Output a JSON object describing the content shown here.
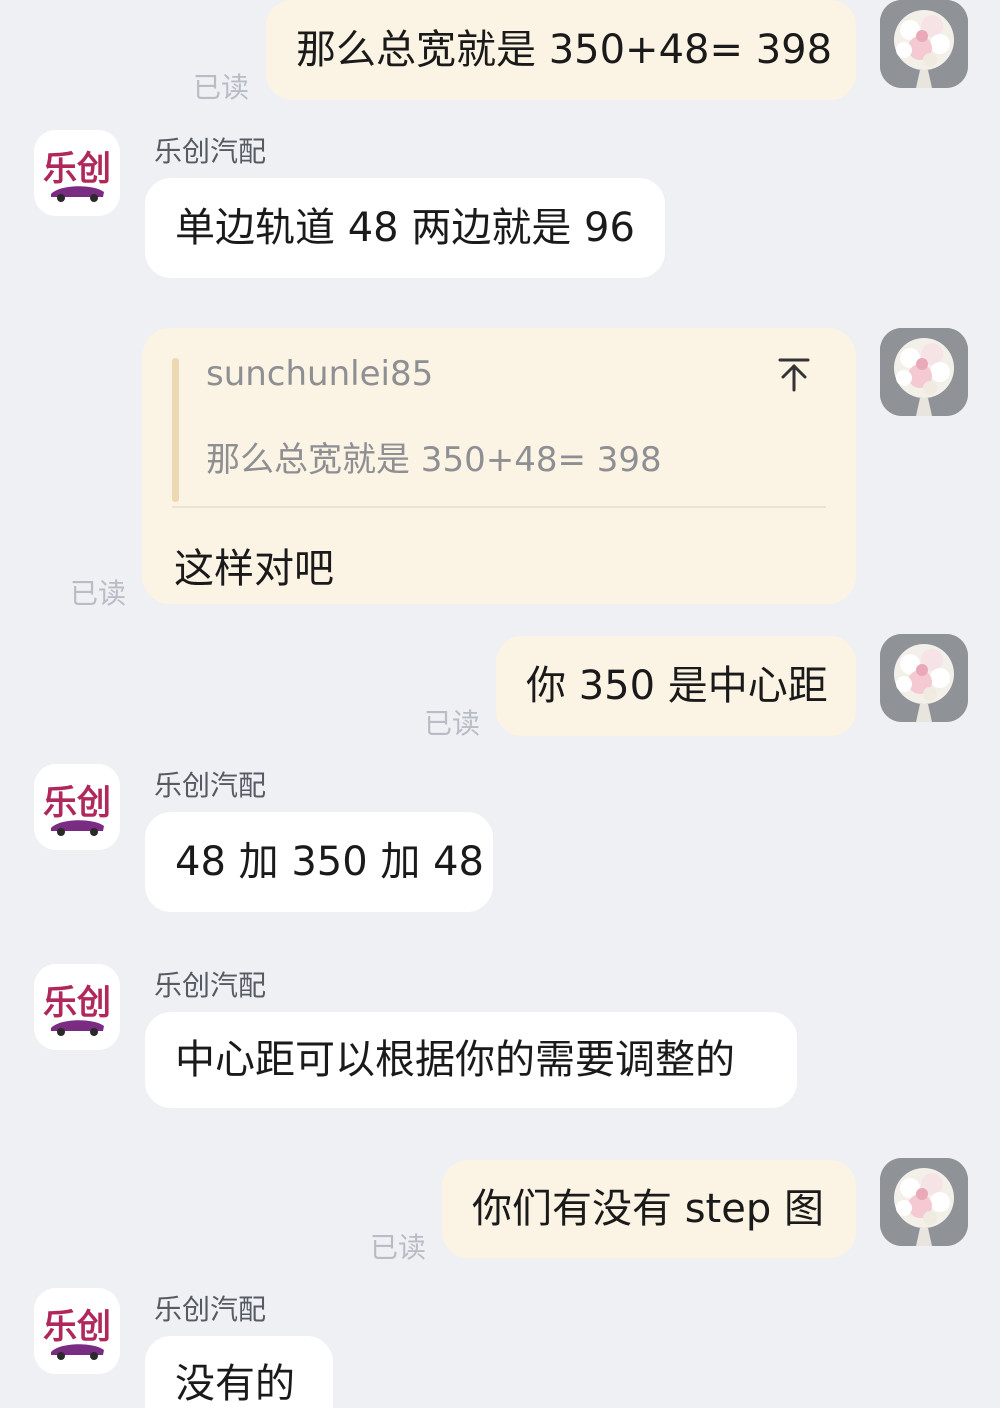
{
  "messages": {
    "m1": {
      "text": "那么总宽就是 350+48= 398",
      "read": "已读"
    },
    "m2": {
      "sender": "乐创汽配",
      "text": "单边轨道 48 两边就是 96"
    },
    "m3": {
      "quote_name": "sunchunlei85",
      "quote_text": "那么总宽就是 350+48= 398",
      "reply": "这样对吧",
      "read": "已读"
    },
    "m4": {
      "text": "你 350 是中心距",
      "read": "已读"
    },
    "m5": {
      "sender": "乐创汽配",
      "text": "48 加 350 加 48"
    },
    "m6": {
      "sender": "乐创汽配",
      "text": "中心距可以根据你的需要调整的"
    },
    "m7": {
      "text": "你们有没有 step 图",
      "read": "已读"
    },
    "m8": {
      "sender": "乐创汽配",
      "text": "没有的"
    }
  },
  "logo": {
    "text": "乐创"
  },
  "colors": {
    "background": "#eef0f4",
    "outgoing_bubble": "#fbf3e4",
    "incoming_bubble": "#ffffff",
    "read_label": "#b8bcc4",
    "logo_accent": "#b0285a"
  },
  "icons": {
    "quote_jump": "arrow-up-to-top-icon",
    "user_avatar": "flower-bouquet-avatar",
    "shop_avatar": "lechuang-car-logo"
  }
}
